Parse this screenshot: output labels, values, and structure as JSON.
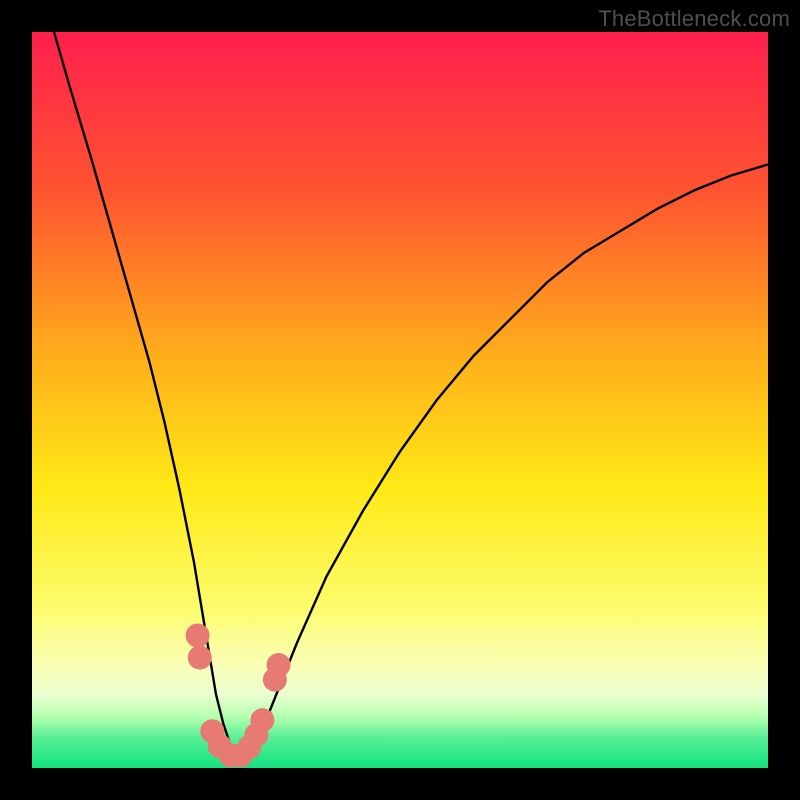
{
  "watermark": "TheBottleneck.com",
  "chart_data": {
    "type": "line",
    "title": "",
    "xlabel": "",
    "ylabel": "",
    "x_range": [
      0,
      100
    ],
    "y_range": [
      0,
      100
    ],
    "series": [
      {
        "name": "bottleneck-curve",
        "x": [
          3,
          5,
          8,
          10,
          12,
          14,
          16,
          18,
          20,
          22,
          23,
          24,
          25,
          26,
          27,
          28,
          29,
          30,
          32,
          34,
          36,
          40,
          45,
          50,
          55,
          60,
          65,
          70,
          75,
          80,
          85,
          90,
          95,
          100
        ],
        "y": [
          100,
          93,
          83,
          76,
          69,
          62,
          55,
          47,
          38,
          28,
          22,
          16,
          10,
          6,
          3,
          1.5,
          1.5,
          3,
          7,
          12,
          17,
          26,
          35,
          43,
          50,
          56,
          61,
          66,
          70,
          73,
          76,
          78.5,
          80.5,
          82
        ]
      }
    ],
    "markers": {
      "name": "highlight-points",
      "color": "#e77a72",
      "radius": 12,
      "points": [
        {
          "x": 22.5,
          "y": 18
        },
        {
          "x": 22.8,
          "y": 15
        },
        {
          "x": 24.5,
          "y": 5
        },
        {
          "x": 25.5,
          "y": 3
        },
        {
          "x": 27.0,
          "y": 1.7
        },
        {
          "x": 28.3,
          "y": 1.7
        },
        {
          "x": 29.5,
          "y": 2.8
        },
        {
          "x": 30.5,
          "y": 4.5
        },
        {
          "x": 31.3,
          "y": 6.5
        },
        {
          "x": 33.0,
          "y": 12
        },
        {
          "x": 33.5,
          "y": 14
        }
      ]
    },
    "gradient_stops": [
      {
        "offset": 0,
        "color": "#ff1f4d"
      },
      {
        "offset": 22,
        "color": "#ff5530"
      },
      {
        "offset": 45,
        "color": "#ffb21a"
      },
      {
        "offset": 62,
        "color": "#ffe916"
      },
      {
        "offset": 78,
        "color": "#fcfc6a"
      },
      {
        "offset": 86,
        "color": "#faffb6"
      },
      {
        "offset": 90,
        "color": "#eaffd0"
      },
      {
        "offset": 93,
        "color": "#b6ffb0"
      },
      {
        "offset": 96,
        "color": "#55ef95"
      },
      {
        "offset": 100,
        "color": "#12e27e"
      }
    ]
  }
}
